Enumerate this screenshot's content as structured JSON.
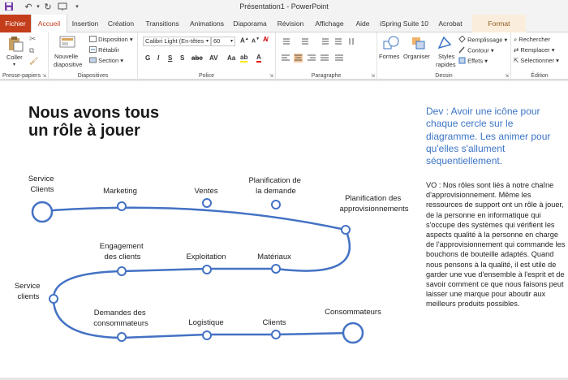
{
  "window": {
    "title": "Présentation1  -  PowerPoint"
  },
  "tabs": [
    {
      "label": "Fichier"
    },
    {
      "label": "Accueil"
    },
    {
      "label": "Insertion"
    },
    {
      "label": "Création"
    },
    {
      "label": "Transitions"
    },
    {
      "label": "Animations"
    },
    {
      "label": "Diaporama"
    },
    {
      "label": "Révision"
    },
    {
      "label": "Affichage"
    },
    {
      "label": "Aide"
    },
    {
      "label": "iSpring Suite 10"
    },
    {
      "label": "Acrobat"
    },
    {
      "label": "Format"
    }
  ],
  "ribbon": {
    "clipboard": {
      "label": "Presse-papiers",
      "paste": "Coller"
    },
    "slides": {
      "label": "Diapositives",
      "new_slide_line1": "Nouvelle",
      "new_slide_line2": "diapositive",
      "layout": "Disposition",
      "reset": "Rétablir",
      "section": "Section"
    },
    "font": {
      "label": "Police",
      "font_name": "Calibri Light (En-têtes",
      "font_size": "60"
    },
    "paragraph": {
      "label": "Paragraphe"
    },
    "drawing": {
      "label": "Dessin",
      "shapes": "Formes",
      "arrange": "Organiser",
      "quick_styles_line1": "Styles",
      "quick_styles_line2": "rapides",
      "fill": "Remplissage",
      "outline": "Contour",
      "effects": "Effets"
    },
    "editing": {
      "label": "Édition",
      "find": "Rechercher",
      "replace": "Remplacer",
      "select": "Sélectionner"
    }
  },
  "slide": {
    "title_line1": "Nous avons tous",
    "title_line2": "un rôle à jouer",
    "dev_note": "Dev : Avoir une icône pour chaque cercle sur le diagramme. Les animer pour qu'elles s'allument séquentiellement.",
    "vo_note": "VO : Nos rôles sont liés à notre chaîne d'approvisionnement. Même les ressources de support ont un rôle à jouer, de la personne en informatique qui s'occupe des systèmes qui vérifient les aspects qualité à la personne en charge de l'approvisionnement qui commande les bouchons de bouteille adaptés. Quand nous pensons à la qualité, il est utile de garder une vue d'ensemble à l'esprit et de savoir comment ce que nous faisons peut laisser une marque pour aboutir aux meilleurs produits possibles."
  },
  "diagram": {
    "labels": {
      "service_clients_1": [
        "Service",
        "Clients"
      ],
      "marketing": [
        "Marketing"
      ],
      "ventes": [
        "Ventes"
      ],
      "planification_demande": [
        "Planification de",
        "la demande"
      ],
      "planification_appro": [
        "Planification des",
        "approvisionnements"
      ],
      "engagement": [
        "Engagement",
        "des clients"
      ],
      "exploitation": [
        "Exploitation"
      ],
      "materiaux": [
        "Matériaux"
      ],
      "service_clients_2": [
        "Service",
        "clients"
      ],
      "demandes": [
        "Demandes des",
        "consommateurs"
      ],
      "logistique": [
        "Logistique"
      ],
      "clients": [
        "Clients"
      ],
      "consommateurs": [
        "Consommateurs"
      ]
    },
    "line_color": "#4472c4"
  }
}
